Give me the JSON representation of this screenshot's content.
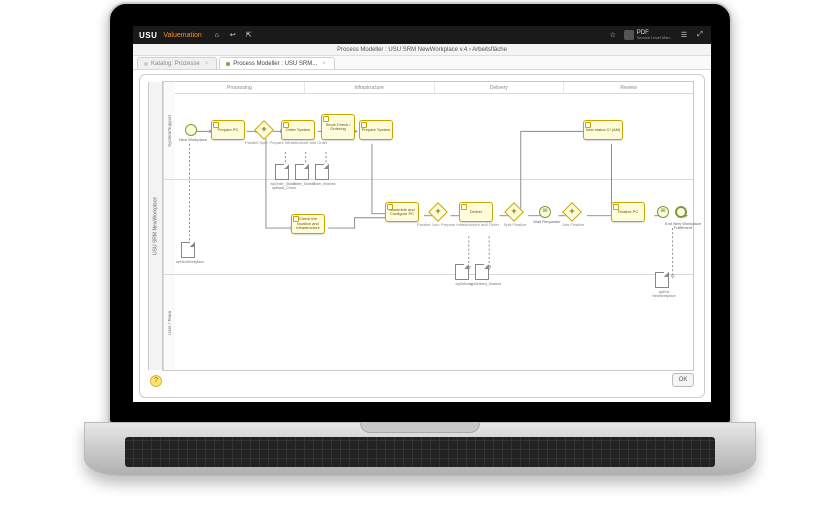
{
  "topbar": {
    "brand": "USU",
    "product": "Valuemation",
    "icons": {
      "home": "⌂",
      "back": "↩",
      "external": "⇱",
      "star": "☆",
      "menu": "☰",
      "expand": "⤢"
    },
    "user": {
      "name": "PDF",
      "role": "Service Level Man..."
    }
  },
  "titlebar": {
    "text": "Process Modeller : USU SRM NewWorkplace v.4 › Arbeitsfläche"
  },
  "tabs": [
    {
      "label": "Katalog: Prozesse",
      "active": false
    },
    {
      "label": "Process Modeller : USU SRM...",
      "active": true
    }
  ],
  "pool": {
    "title": "USU SRM NewWorkplace"
  },
  "lanes": [
    {
      "id": "lane1",
      "title": "System/Support"
    },
    {
      "id": "lane2",
      "title": ""
    },
    {
      "id": "lane3",
      "title": "User / Team"
    }
  ],
  "phases": [
    "Processing",
    "Infrastructure",
    "Delivery",
    "Review"
  ],
  "nodes": {
    "start": {
      "label": "New Workplace"
    },
    "prepare": {
      "label": "Prepare PC"
    },
    "order": {
      "label": "Order System"
    },
    "stock": {
      "label": "Stock Check / Ordering"
    },
    "prepsys": {
      "label": "Prepare System"
    },
    "gw_split1": {
      "label": "Parallel Split: Prepare Infrastructure and Order"
    },
    "doc_sysback": {
      "label": "wpOrder_Status / wpBack_Check"
    },
    "doc_ordstart": {
      "label": "Order_Started"
    },
    "doc_ordfin": {
      "label": "Order_finished"
    },
    "doc_wp": {
      "label": "wpNewWorkplace"
    },
    "checkloc": {
      "label": "Check the location and infrastructure"
    },
    "assemble": {
      "label": "Assemble and Configure PC"
    },
    "gw_join1": {
      "label": "Parallel Join: Prepare Infrastructure and Order"
    },
    "deliver": {
      "label": "Deliver"
    },
    "gw_splitfin": {
      "label": "Split Finalize"
    },
    "evt_wait": {
      "label": "Wait Requester"
    },
    "gw_joinfin": {
      "label": "Join Finalize"
    },
    "newstatus": {
      "label": "New status CI (AM)"
    },
    "finalize": {
      "label": "Finalize PC"
    },
    "evt_msg": {
      "label": ""
    },
    "end": {
      "label": "End New Workplace Fulfillment"
    },
    "doc_deliv1": {
      "label": "wpDelivery"
    },
    "doc_deliv2": {
      "label": "wpDelivery_finished"
    },
    "doc_wpend": {
      "label": "wpEnd NewWorkplace"
    }
  },
  "buttons": {
    "help": "?",
    "ok": "OK"
  }
}
